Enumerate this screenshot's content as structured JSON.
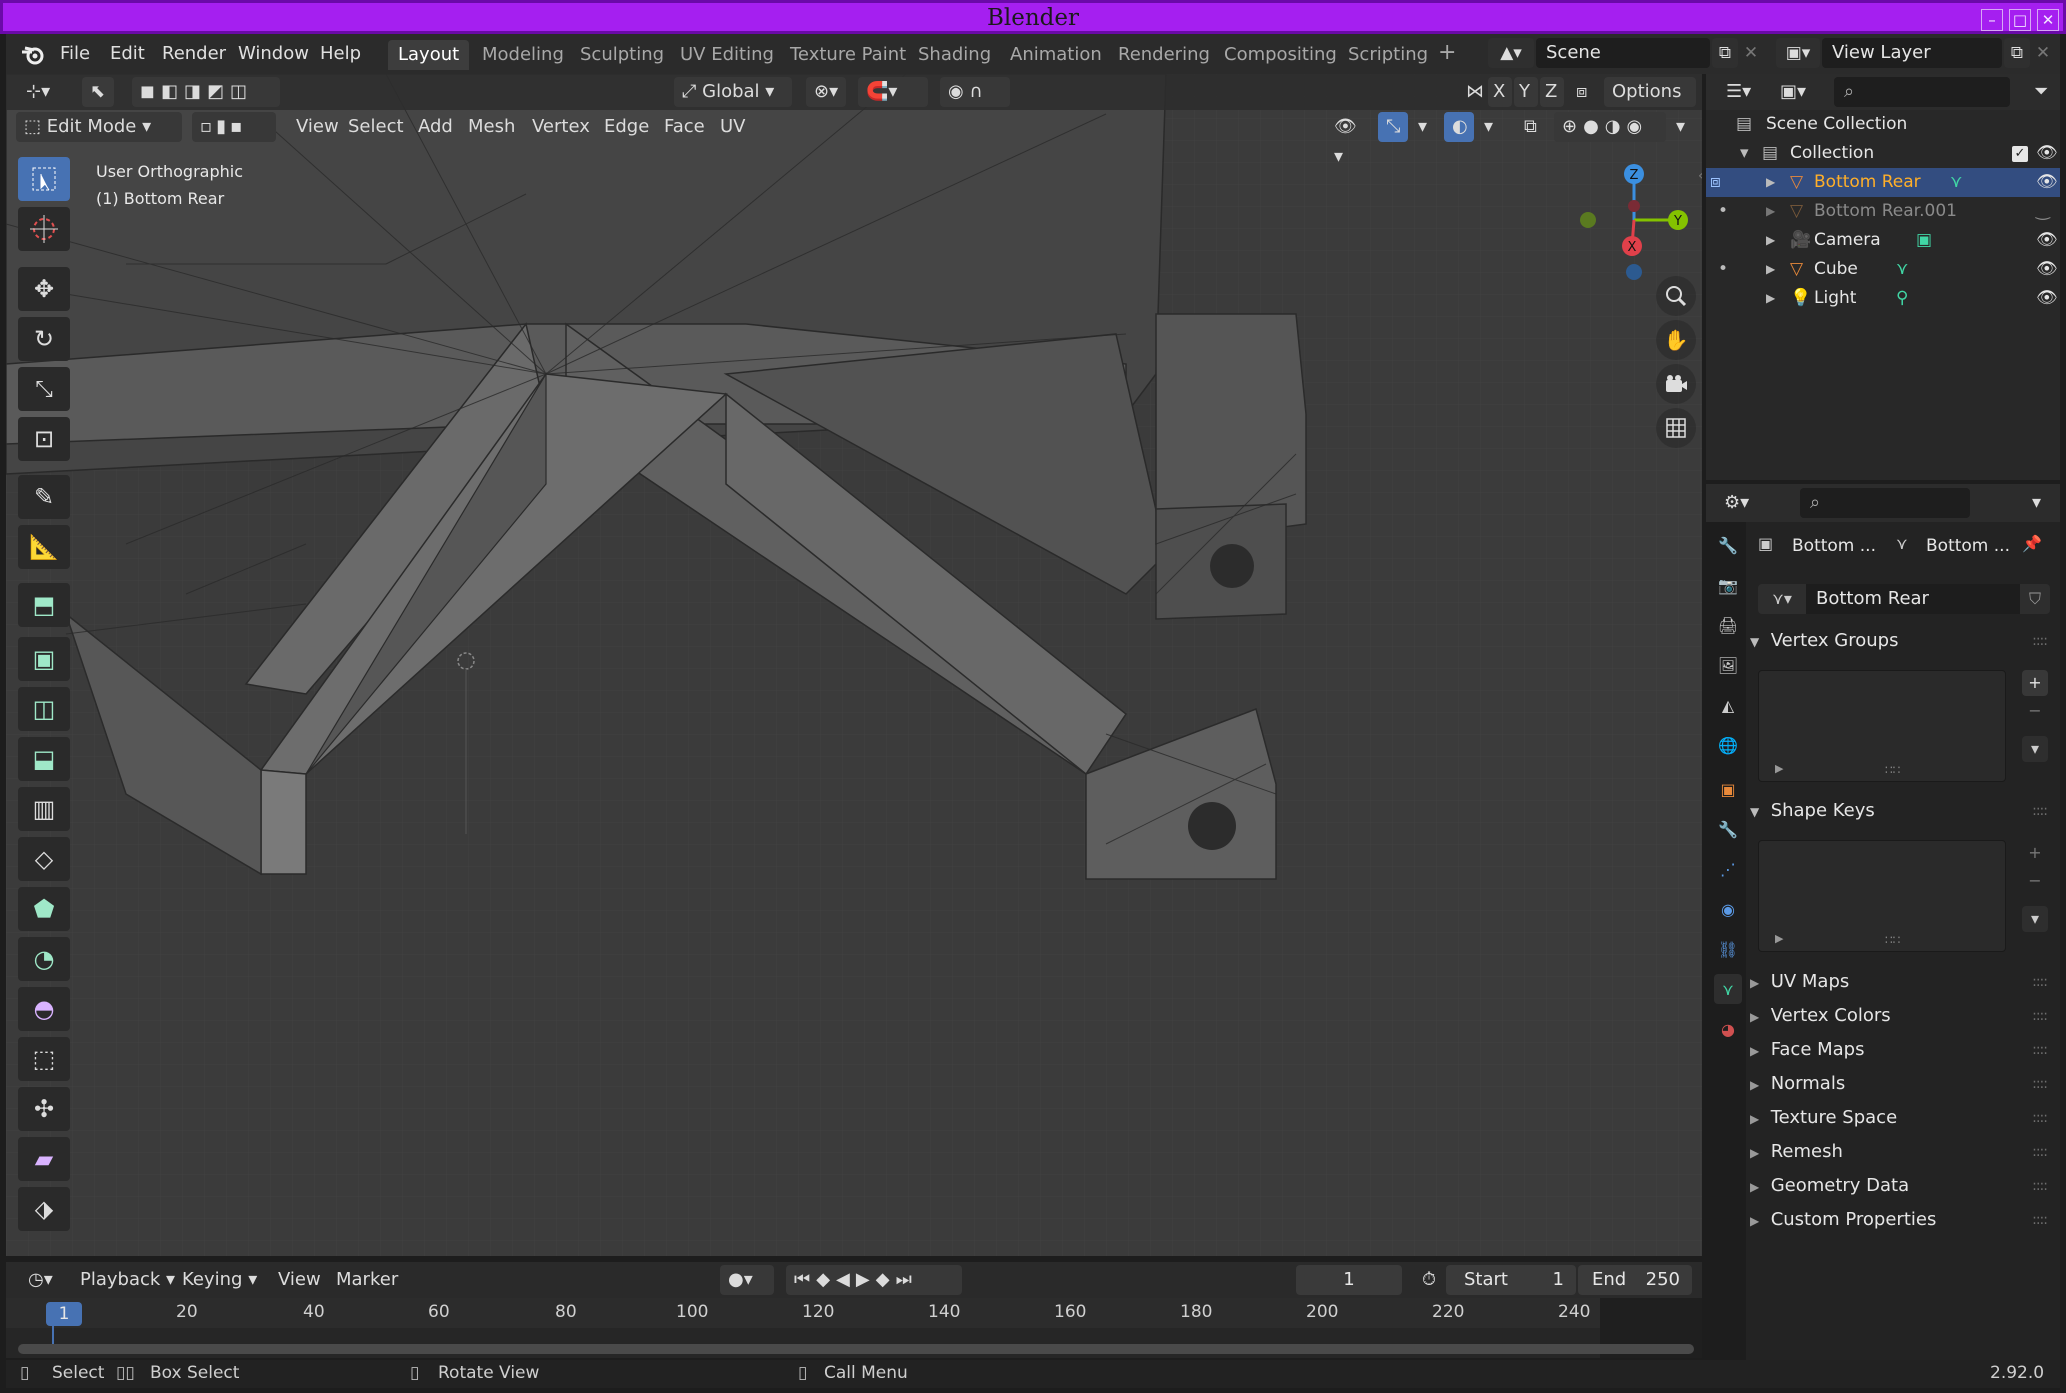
{
  "window": {
    "title": "Blender"
  },
  "menubar": {
    "items": [
      "File",
      "Edit",
      "Render",
      "Window",
      "Help"
    ]
  },
  "workspaces": {
    "tabs": [
      "Layout",
      "Modeling",
      "Sculpting",
      "UV Editing",
      "Texture Paint",
      "Shading",
      "Animation",
      "Rendering",
      "Compositing",
      "Scripting"
    ],
    "active": "Layout"
  },
  "scene": {
    "name": "Scene"
  },
  "view_layer": {
    "name": "View Layer"
  },
  "tool_header": {
    "orientation": "Global",
    "options_label": "Options",
    "axes": [
      "X",
      "Y",
      "Z"
    ]
  },
  "viewport_header": {
    "mode": "Edit Mode",
    "menus": [
      "View",
      "Select",
      "Add",
      "Mesh",
      "Vertex",
      "Edge",
      "Face",
      "UV"
    ]
  },
  "viewport": {
    "view_name": "User Orthographic",
    "object_label": "(1) Bottom Rear"
  },
  "gizmo": {
    "z": "Z",
    "y": "Y",
    "x": "X"
  },
  "outliner": {
    "root": "Scene Collection",
    "collection": "Collection",
    "items": [
      {
        "label": "Bottom Rear",
        "selected": true
      },
      {
        "label": "Bottom Rear.001",
        "selected": false
      },
      {
        "label": "Camera",
        "selected": false
      },
      {
        "label": "Cube",
        "selected": false
      },
      {
        "label": "Light",
        "selected": false
      }
    ]
  },
  "properties": {
    "breadcrumb_object": "Bottom ...",
    "breadcrumb_data": "Bottom ...",
    "mesh_name": "Bottom Rear",
    "panels": {
      "vertex_groups": "Vertex Groups",
      "shape_keys": "Shape Keys",
      "collapsed": [
        "UV Maps",
        "Vertex Colors",
        "Face Maps",
        "Normals",
        "Texture Space",
        "Remesh",
        "Geometry Data",
        "Custom Properties"
      ]
    }
  },
  "timeline": {
    "menus": [
      "Playback",
      "Keying",
      "View",
      "Marker"
    ],
    "current_frame": "1",
    "start_label": "Start",
    "start": "1",
    "end_label": "End",
    "end": "250",
    "ruler": [
      "20",
      "40",
      "60",
      "80",
      "100",
      "120",
      "140",
      "160",
      "180",
      "200",
      "220",
      "240"
    ],
    "playhead": "1"
  },
  "statusbar": {
    "select": "Select",
    "box_select": "Box Select",
    "rotate": "Rotate View",
    "call_menu": "Call Menu",
    "version": "2.92.0"
  },
  "colors": {
    "title_bar": "#a51ff0",
    "selection": "#4772b3",
    "mesh_icon": "#41d6a5",
    "object_icon": "#e8893a"
  }
}
